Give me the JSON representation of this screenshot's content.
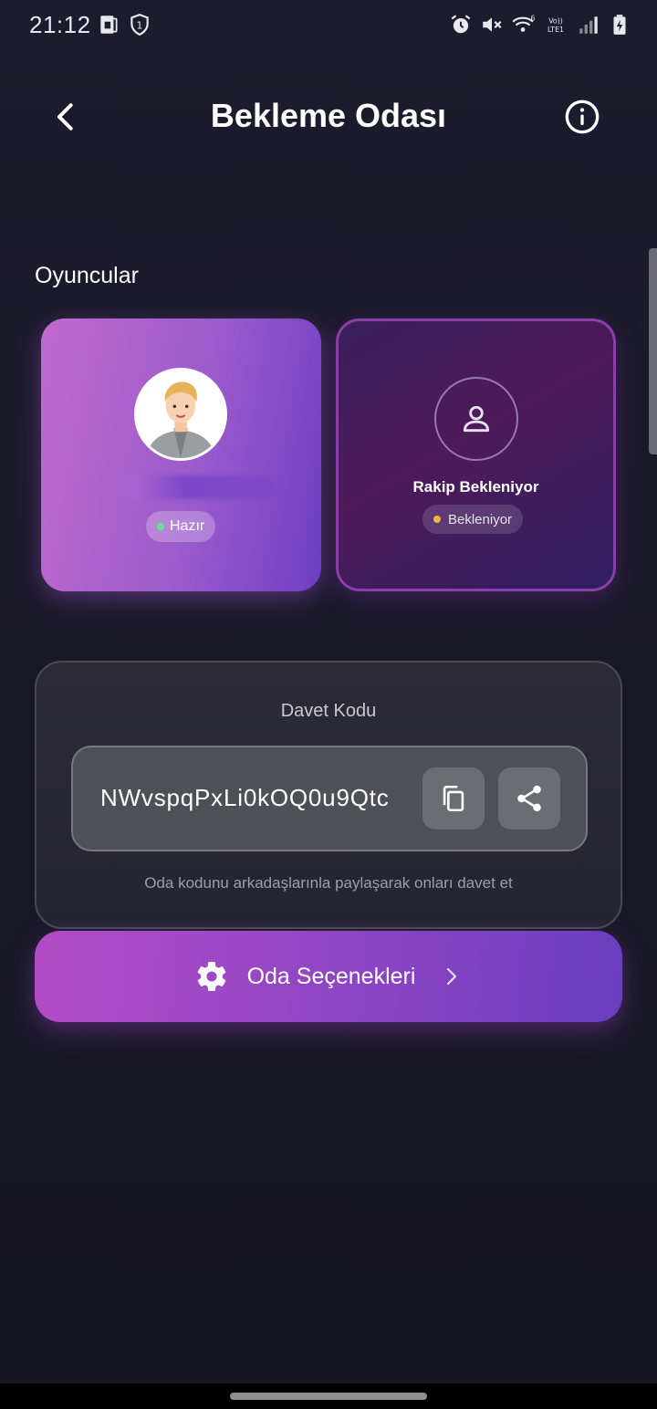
{
  "status_bar": {
    "time": "21:12",
    "left_icons": [
      "sim-card-icon",
      "vpn-shield-icon"
    ],
    "right_icons": [
      "alarm-icon",
      "mute-icon",
      "wifi-icon",
      "volte-icon",
      "signal-icon",
      "battery-charging-icon"
    ],
    "vo_label": "Vo))",
    "lte_label": "LTE1",
    "wifi_label": "6"
  },
  "header": {
    "title": "Bekleme Odası",
    "back_icon": "back-arrow-icon",
    "info_icon": "info-icon"
  },
  "players": {
    "section_title": "Oyuncular",
    "me": {
      "status": "Hazır",
      "status_color": "#5ee88a"
    },
    "opponent": {
      "label": "Rakip Bekleniyor",
      "status": "Bekleniyor",
      "status_color": "#f5b63a"
    }
  },
  "invite": {
    "title": "Davet Kodu",
    "code": "NWvspqPxLi0kOQ0u9Qtc",
    "hint": "Oda kodunu arkadaşlarınla paylaşarak onları davet et",
    "copy_icon": "copy-icon",
    "share_icon": "share-icon"
  },
  "options_button": {
    "label": "Oda Seçenekleri",
    "icon": "gear-icon"
  },
  "colors": {
    "background": "#1b1a2b",
    "accent_purple": "#9046c4",
    "accent_pink": "#b44bc6"
  }
}
